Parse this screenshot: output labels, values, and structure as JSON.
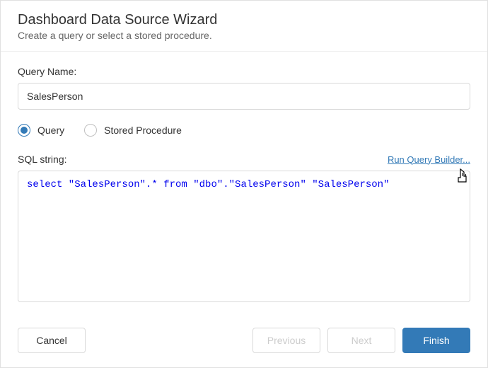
{
  "header": {
    "title": "Dashboard Data Source Wizard",
    "subtitle": "Create a query or select a stored procedure."
  },
  "queryName": {
    "label": "Query Name:",
    "value": "SalesPerson"
  },
  "typeOptions": {
    "query": "Query",
    "storedProcedure": "Stored Procedure",
    "selected": "query"
  },
  "sql": {
    "label": "SQL string:",
    "runLink": "Run Query Builder...",
    "text": "select \"SalesPerson\".* from \"dbo\".\"SalesPerson\" \"SalesPerson\""
  },
  "footer": {
    "cancel": "Cancel",
    "previous": "Previous",
    "next": "Next",
    "finish": "Finish"
  }
}
